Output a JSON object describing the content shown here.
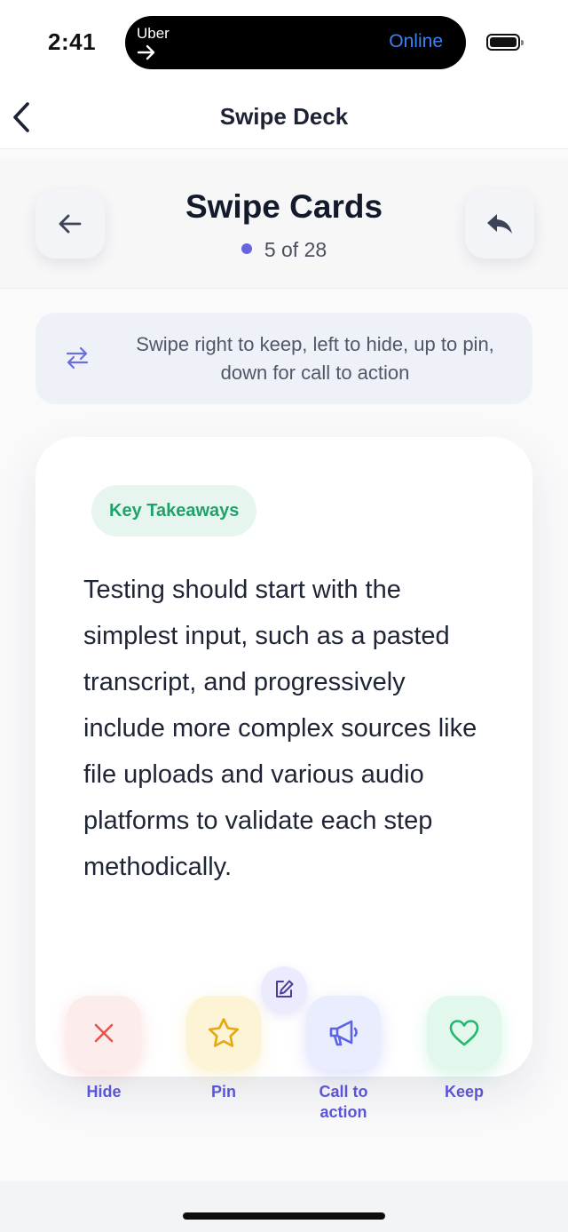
{
  "status_bar": {
    "time": "2:41",
    "live_activity_app": "Uber",
    "live_activity_status": "Online",
    "live_activity_status_color": "#3c82f6"
  },
  "nav": {
    "title": "Swipe Deck",
    "back_icon": "chevron-left-icon"
  },
  "header": {
    "title": "Swipe Cards",
    "progress": "5 of 28",
    "progress_dot_color": "#6565e0",
    "left_icon": "arrow-left-icon",
    "right_icon": "undo-icon"
  },
  "instruction": {
    "icon": "swap-arrows-icon",
    "text": "Swipe right to keep, left to hide, up to pin, down for call to action"
  },
  "card": {
    "tag": "Key Takeaways",
    "tag_color": "#1fa26a",
    "body": "Testing should start with the simplest input, such as a pasted transcript, and progressively include more complex sources like file uploads and various audio platforms to validate each step methodically."
  },
  "actions": [
    {
      "label": "Hide",
      "icon": "close-icon",
      "color": "#e8534a"
    },
    {
      "label": "Pin",
      "icon": "star-icon",
      "color": "#e5a80f"
    },
    {
      "label": "Call to action",
      "icon": "megaphone-icon",
      "color": "#5a64e8"
    },
    {
      "label": "Keep",
      "icon": "heart-icon",
      "color": "#23b772"
    }
  ],
  "edit_icon": "edit-icon"
}
